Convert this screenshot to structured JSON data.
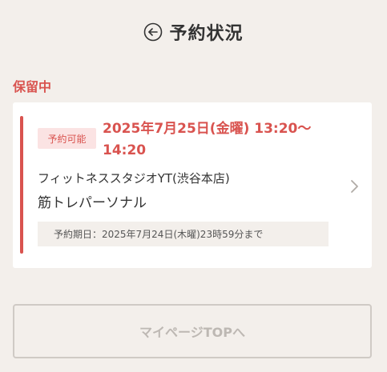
{
  "header": {
    "back_icon": "circle-arrow-left-icon",
    "title": "予約状況"
  },
  "section": {
    "label": "保留中"
  },
  "reservation": {
    "status_badge": "予約可能",
    "datetime_line1": "2025年7月25日(金曜) 13:20〜",
    "datetime_line2": "14:20",
    "studio": "フィットネススタジオYT(渋谷本店)",
    "lesson": "筋トレパーソナル",
    "deadline": "予約期日：2025年7月24日(木曜)23時59分まで",
    "chevron_icon": "chevron-right-icon"
  },
  "footer": {
    "mypage_button": "マイページTOPへ"
  },
  "colors": {
    "accent": "#d9534f",
    "background": "#f3efeb",
    "card": "#ffffff",
    "badge_bg": "#fbe3e3",
    "disabled_text": "#bdb8b3"
  }
}
